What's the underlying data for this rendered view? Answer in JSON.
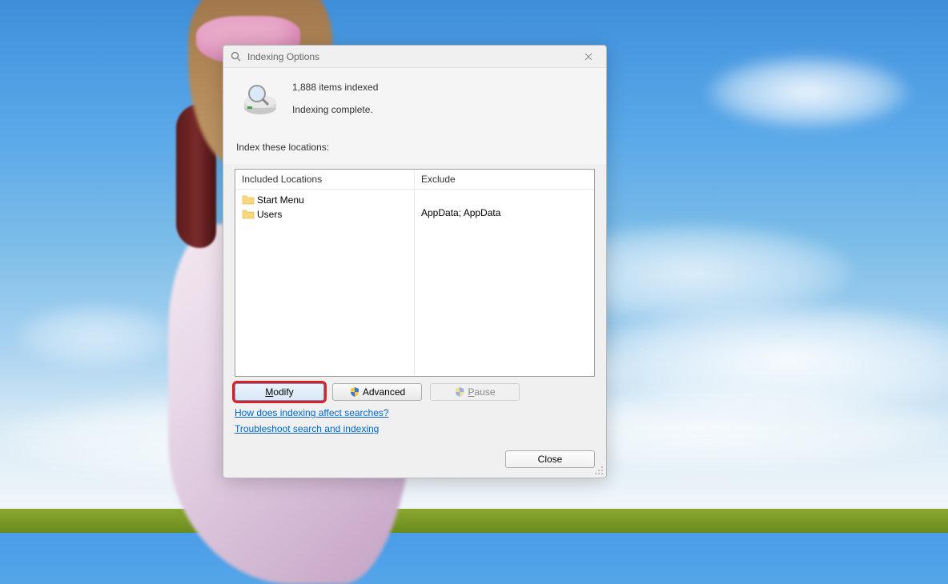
{
  "dialog": {
    "title": "Indexing Options",
    "items_indexed": "1,888 items indexed",
    "status": "Indexing complete.",
    "locations_label": "Index these locations:",
    "columns": {
      "included": "Included Locations",
      "exclude": "Exclude"
    },
    "rows": [
      {
        "included": "Start Menu",
        "exclude": ""
      },
      {
        "included": "Users",
        "exclude": "AppData; AppData"
      }
    ],
    "buttons": {
      "modify": "Modify",
      "advanced": "Advanced",
      "pause": "Pause",
      "close": "Close"
    },
    "links": {
      "how": "How does indexing affect searches?",
      "troubleshoot": "Troubleshoot search and indexing"
    }
  }
}
